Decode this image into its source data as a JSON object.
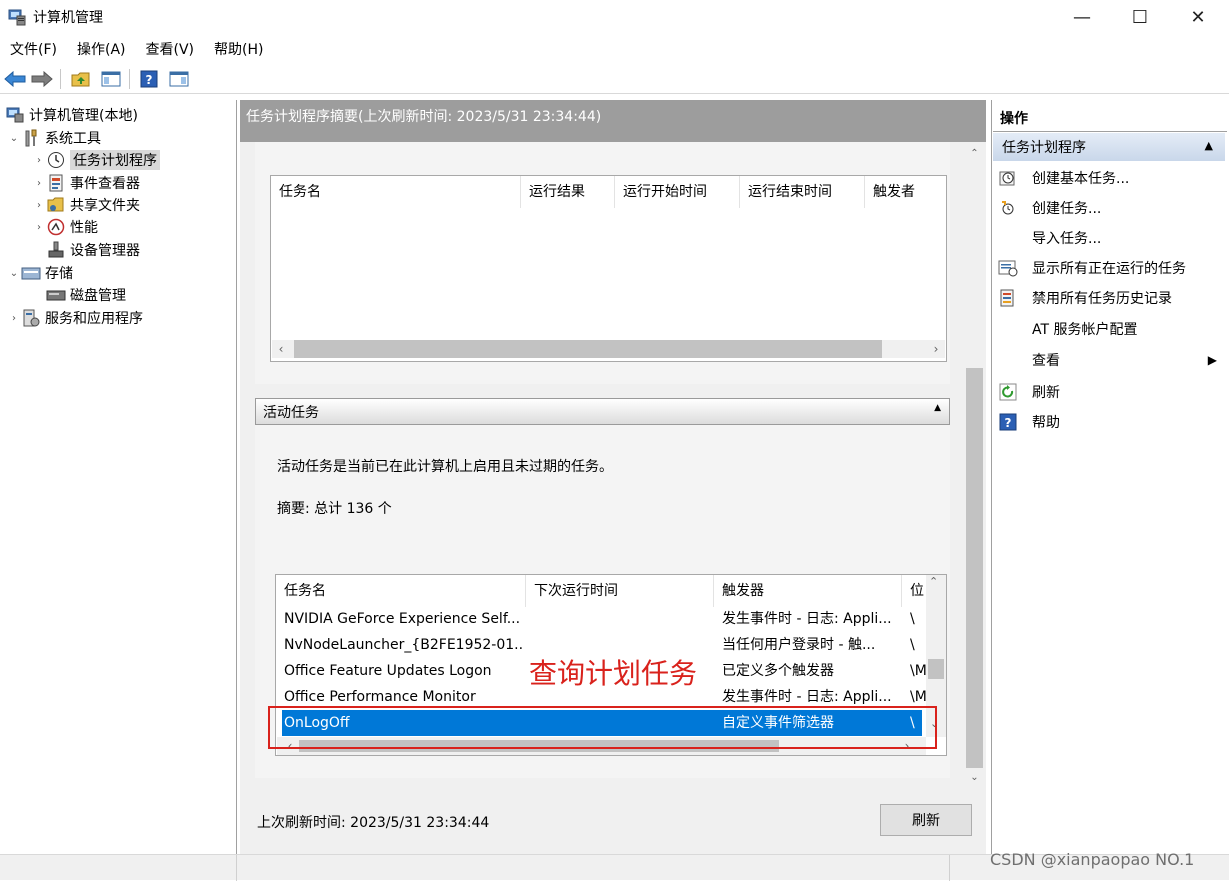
{
  "window": {
    "title": "计算机管理",
    "minimize": "—",
    "maximize": "☐",
    "close": "✕"
  },
  "menu": [
    "文件(F)",
    "操作(A)",
    "查看(V)",
    "帮助(H)"
  ],
  "toolbar_icons": [
    "back-arrow-icon",
    "forward-arrow-icon",
    "up-folder-icon",
    "show-hide-tree-icon",
    "help-icon",
    "show-hide-action-pane-icon"
  ],
  "tree": {
    "root": "计算机管理(本地)",
    "system_tools": "系统工具",
    "task_scheduler": "任务计划程序",
    "event_viewer": "事件查看器",
    "shared_folders": "共享文件夹",
    "performance": "性能",
    "device_manager": "设备管理器",
    "storage": "存储",
    "disk_management": "磁盘管理",
    "services_apps": "服务和应用程序"
  },
  "summary": {
    "header": "任务计划程序摘要(上次刷新时间: 2023/5/31 23:34:44)",
    "columns": [
      "任务名",
      "运行结果",
      "运行开始时间",
      "运行结束时间",
      "触发者"
    ]
  },
  "active": {
    "header": "活动任务",
    "description": "活动任务是当前已在此计算机上启用且未过期的任务。",
    "summary_text": "摘要: 总计 136 个",
    "columns": [
      "任务名",
      "下次运行时间",
      "触发器",
      "位"
    ],
    "rows": [
      {
        "name": "NVIDIA GeForce Experience Self...",
        "next": "",
        "trigger": "发生事件时 - 日志: Appli...",
        "loc": "\\"
      },
      {
        "name": "NvNodeLauncher_{B2FE1952-01...",
        "next": "",
        "trigger": "当任何用户登录时 - 触...",
        "loc": "\\"
      },
      {
        "name": "Office Feature Updates Logon",
        "next": "",
        "trigger": "已定义多个触发器",
        "loc": "\\M"
      },
      {
        "name": "Office Performance Monitor",
        "next": "",
        "trigger": "发生事件时 - 日志: Appli...",
        "loc": "\\M"
      },
      {
        "name": "OnLogOff",
        "next": "",
        "trigger": "自定义事件筛选器",
        "loc": "\\"
      }
    ],
    "selected_index": 4
  },
  "annotation": "查询计划任务",
  "footer": {
    "last_refresh": "上次刷新时间: 2023/5/31 23:34:44",
    "refresh_button": "刷新"
  },
  "actions": {
    "title": "操作",
    "section": "任务计划程序",
    "items": [
      {
        "label": "创建基本任务...",
        "icon": "create-basic-task-icon"
      },
      {
        "label": "创建任务...",
        "icon": "create-task-icon"
      },
      {
        "label": "导入任务...",
        "icon": ""
      },
      {
        "label": "显示所有正在运行的任务",
        "icon": "running-tasks-icon"
      },
      {
        "label": "禁用所有任务历史记录",
        "icon": "history-icon"
      },
      {
        "label": "AT 服务帐户配置",
        "icon": ""
      },
      {
        "label": "查看",
        "icon": ""
      },
      {
        "label": "刷新",
        "icon": "refresh-icon"
      },
      {
        "label": "帮助",
        "icon": "help-icon"
      }
    ]
  },
  "watermark": "CSDN @xianpaopao NO.1",
  "colors": {
    "selection": "#0078d7",
    "annotation": "#d9221c",
    "header_gray": "#9d9d9d"
  }
}
